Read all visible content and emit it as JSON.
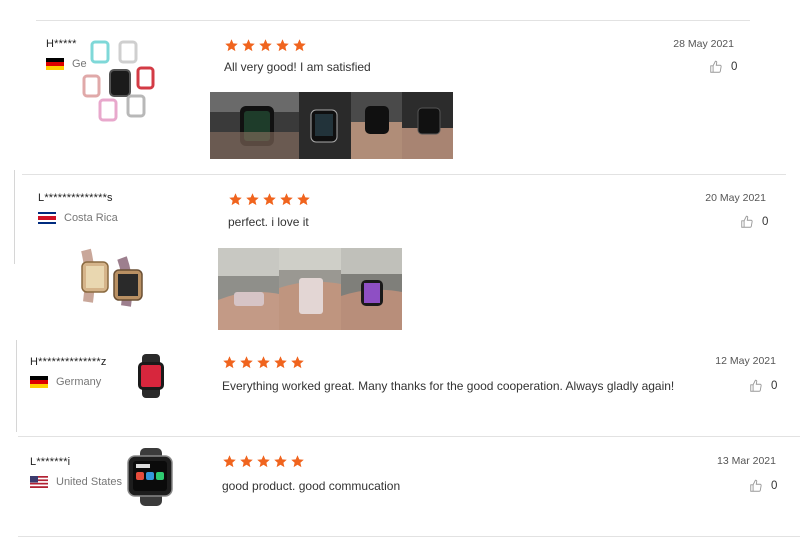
{
  "reviews": [
    {
      "name": "H*****",
      "country": "Ge",
      "rating": 5,
      "text": "All very good! I am satisfied",
      "date": "28 May 2021",
      "likes": "0",
      "product": "watch-case-set-image",
      "photos": 4
    },
    {
      "name": "L**************s",
      "country": "Costa Rica",
      "rating": 5,
      "text": "perfect. i love it",
      "date": "20 May 2021",
      "likes": "0",
      "product": "resin-watch-band-image",
      "photos": 3
    },
    {
      "name": "H**************z",
      "country": "Germany",
      "rating": 5,
      "text": "Everything worked great. Many thanks for the good cooperation. Always gladly again!",
      "date": "12 May 2021",
      "likes": "0",
      "product": "smartwatch-red-image",
      "photos": 0
    },
    {
      "name": "L*******i",
      "country": "United States",
      "rating": 5,
      "text": "good product. good commucation",
      "date": "13 Mar 2021",
      "likes": "0",
      "product": "smartwatch-black-image",
      "photos": 0
    }
  ],
  "colors": {
    "star": "#f0641e",
    "divider": "#e2e2e2",
    "text": "#333333",
    "muted": "#777777"
  }
}
